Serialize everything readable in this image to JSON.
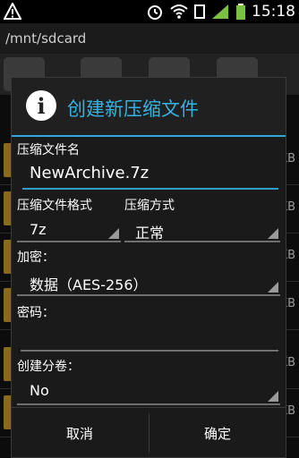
{
  "status_bar": {
    "time": "15:18"
  },
  "background": {
    "path": "/mnt/sdcard",
    "row_sizes": [
      "KB",
      "KB",
      "KB",
      "KB",
      "KB",
      "KB"
    ]
  },
  "dialog": {
    "title": "创建新压缩文件",
    "name_label": "压缩文件名",
    "name_value": "NewArchive.7z",
    "format_label": "压缩文件格式",
    "format_value": "7z",
    "method_label": "压缩方式",
    "method_value": "正常",
    "encrypt_label": "加密：",
    "encrypt_value": "数据（AES-256）",
    "password_label": "密码：",
    "password_value": "",
    "split_label": "创建分卷：",
    "split_value": "No",
    "cancel_label": "取消",
    "ok_label": "确定"
  },
  "colors": {
    "accent": "#36b2e2",
    "underline_active": "#2e9dcc"
  }
}
